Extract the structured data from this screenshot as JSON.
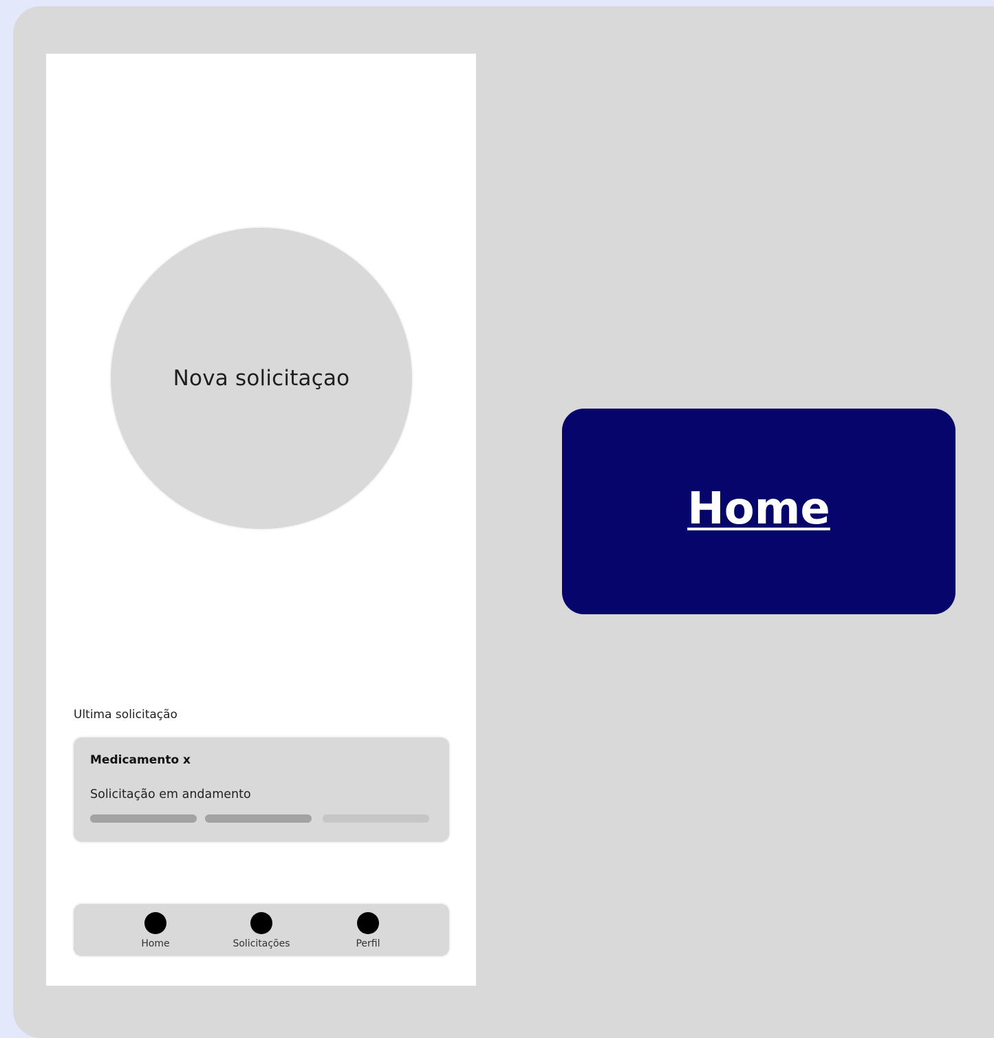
{
  "colors": {
    "page_background": "#e3e9fb",
    "panel_background": "#d9d9d9",
    "screen_background": "#ffffff",
    "badge_background": "#05056b",
    "badge_text": "#ffffff",
    "progress_done": "#a3a3a3",
    "progress_pending": "#c6c6c6"
  },
  "phone": {
    "new_request_button": "Nova solicitaçao",
    "last_request_label": "Ultima solicitação",
    "last_request": {
      "title": "Medicamento x",
      "status": "Solicitação em andamento",
      "progress_steps": [
        {
          "state": "done"
        },
        {
          "state": "done"
        },
        {
          "state": "pending"
        }
      ]
    },
    "bottom_nav": [
      {
        "label": "Home",
        "icon": "circle-icon"
      },
      {
        "label": "Solicitações",
        "icon": "circle-icon"
      },
      {
        "label": "Perfil",
        "icon": "circle-icon"
      }
    ]
  },
  "screen_title": {
    "label": "Home"
  }
}
